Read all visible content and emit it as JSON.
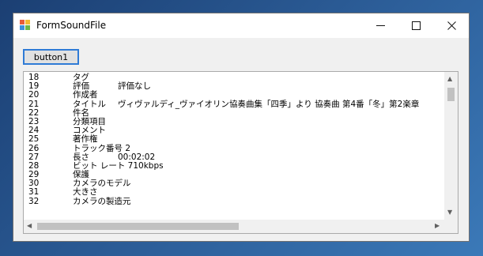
{
  "window": {
    "title": "FormSoundFile",
    "controls": {
      "minimize": "—",
      "maximize": "☐",
      "close": "✕"
    }
  },
  "form": {
    "button_label": "button1"
  },
  "textbox": {
    "lines": [
      {
        "num": "18",
        "name": "タグ",
        "value": ""
      },
      {
        "num": "19",
        "name": "評価",
        "value": "評価なし"
      },
      {
        "num": "20",
        "name": "作成者",
        "value": ""
      },
      {
        "num": "21",
        "name": "タイトル",
        "value": "ヴィヴァルディ_ヴァイオリン協奏曲集「四季」より 協奏曲 第4番「冬」第2楽章"
      },
      {
        "num": "22",
        "name": "件名",
        "value": ""
      },
      {
        "num": "23",
        "name": "分類項目",
        "value": ""
      },
      {
        "num": "24",
        "name": "コメント",
        "value": ""
      },
      {
        "num": "25",
        "name": "著作権",
        "value": ""
      },
      {
        "num": "26",
        "name": "トラック番号 2",
        "value": ""
      },
      {
        "num": "27",
        "name": "長さ",
        "value": "00:02:02"
      },
      {
        "num": "28",
        "name": "ビット レート 710kbps",
        "value": ""
      },
      {
        "num": "29",
        "name": "保護",
        "value": ""
      },
      {
        "num": "30",
        "name": "カメラのモデル",
        "value": ""
      },
      {
        "num": "31",
        "name": "大きさ",
        "value": ""
      },
      {
        "num": "32",
        "name": "カメラの製造元",
        "value": ""
      }
    ]
  },
  "colors": {
    "accent": "#2f7bd6",
    "window_bg": "#f0f0f0",
    "titlebar_bg": "#ffffff"
  },
  "icons": [
    "app-icon",
    "minimize-icon",
    "maximize-icon",
    "close-icon",
    "scroll-up-icon",
    "scroll-down-icon",
    "scroll-left-icon",
    "scroll-right-icon"
  ]
}
